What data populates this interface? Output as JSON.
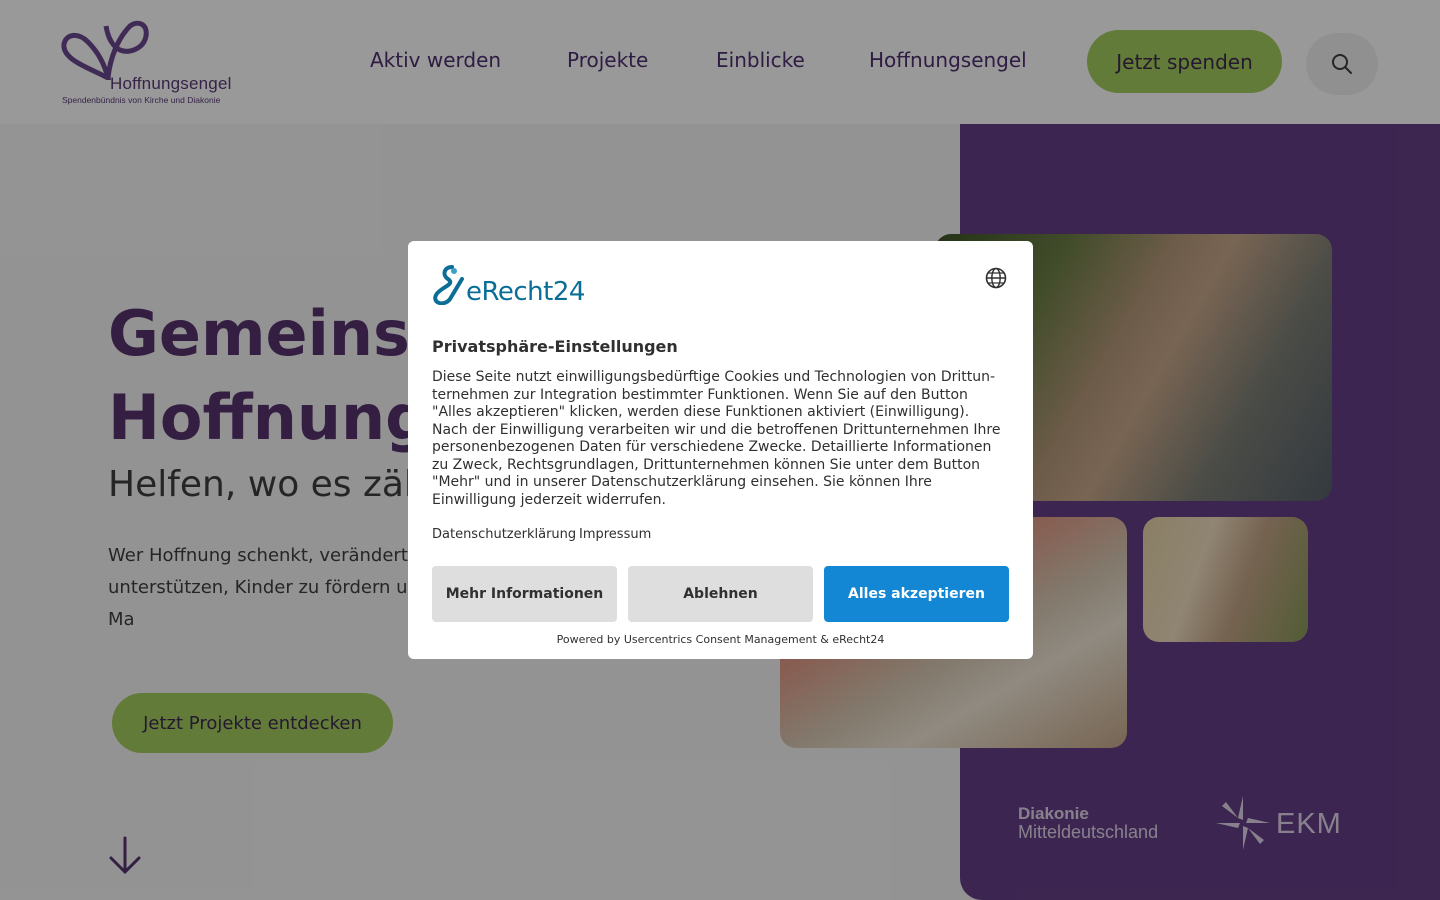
{
  "header": {
    "logo": {
      "title": "Hoffnungsengel",
      "subtitle": "Spendenbündnis von Kirche und Diakonie"
    },
    "nav": [
      "Aktiv werden",
      "Projekte",
      "Einblicke",
      "Hoffnungsengel"
    ],
    "donate_label": "Jetzt spenden",
    "search_icon": "search-icon"
  },
  "hero": {
    "title_line1": "Gemeinsam",
    "title_line2": "Hoffnung",
    "subtitle": "Helfen, wo es zäh",
    "text": "Wer Hoffnung schenkt, verändert unserer Mission und helfen Sie un unterstützen, Kinder zu fördern un realisieren. Jeder Beitrag zählt. Ma",
    "cta_label": "Jetzt Projekte entdecken",
    "scroll_icon": "arrow-down-icon"
  },
  "partners": {
    "diakonie_line1": "Diakonie",
    "diakonie_line2": "Mitteldeutschland",
    "ekm": "EKM"
  },
  "consent": {
    "brand": "eRecht24",
    "language_icon": "globe-icon",
    "title": "Privatsphäre-Einstellungen",
    "body": "Diese Seite nutzt einwilligungsbedürftige Cookies und Technologien von Drittun-ternehmen zur Integration bestimmter Funktionen. Wenn Sie auf den Button \"Alles akzeptieren\" klicken, werden diese Funktionen aktiviert (Einwilligung). Nach der Einwilligung verarbeiten wir und die betroffenen Drittunternehmen Ihre personenbezogenen Daten für verschiedene Zwecke. Detaillierte Informationen zu Zweck, Rechtsgrundlagen, Drittunternehmen können Sie unter dem Button \"Mehr\" und in unserer Datenschutzerklärung einsehen. Sie können Ihre Einwilligung jederzeit widerrufen.",
    "link_privacy": "Datenschutzerklärung",
    "link_imprint": "Impressum",
    "btn_more": "Mehr Informationen",
    "btn_deny": "Ablehnen",
    "btn_accept": "Alles akzeptieren",
    "powered_by": "Powered by Usercentrics Consent Management & eRecht24"
  },
  "colors": {
    "brand_purple": "#57336f",
    "panel_purple": "#653f86",
    "accent_green": "#a6cd5e",
    "accept_blue": "#1487d4"
  }
}
